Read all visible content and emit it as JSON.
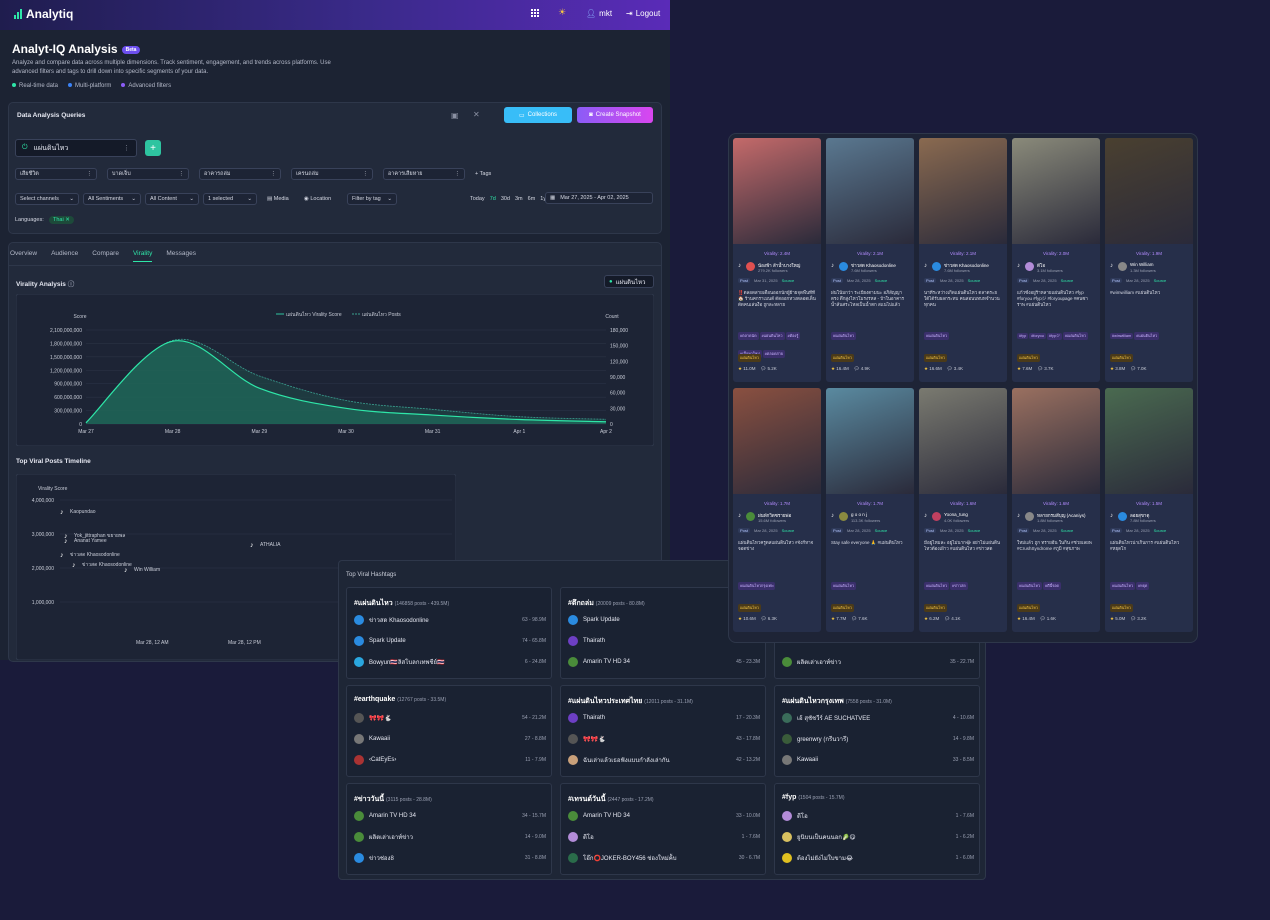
{
  "app": {
    "name": "Analytiq",
    "user": "mkt",
    "logout": "Logout"
  },
  "page": {
    "title": "Analyt-IQ Analysis",
    "badge": "Beta",
    "description": "Analyze and compare data across multiple dimensions. Track sentiment, engagement, and trends across platforms. Use advanced filters and tags to drill down into specific segments of your data.",
    "features": [
      "Real-time data",
      "Multi-platform",
      "Advanced filters"
    ]
  },
  "queries": {
    "title": "Data Analysis Queries",
    "collections": "Collections",
    "snapshot": "Create Snapshot",
    "active_query": "แผ่นดินไหว",
    "tags": [
      "เสียชีวิต",
      "บาดเจ็บ",
      "อาคารถล่ม",
      "เครนถล่ม",
      "อาคารเสียหาย"
    ],
    "tags_label": "Tags",
    "filters": [
      "Select channels",
      "All Sentiments",
      "All Content",
      "1 selected"
    ],
    "media": "Media",
    "location": "Location",
    "filter_by_tag": "Filter by tag",
    "ranges": [
      "Today",
      "7d",
      "30d",
      "3m",
      "6m",
      "1y"
    ],
    "date_range": "Mar 27, 2025 - Apr 02, 2025",
    "languages_label": "Languages:",
    "language": "Thai"
  },
  "tabs": [
    "Overview",
    "Audience",
    "Compare",
    "Virality",
    "Messages"
  ],
  "virality": {
    "title": "Virality Analysis",
    "keyword": "แผ่นดินไหว",
    "legend": [
      "แผ่นดินไหว Virality Score",
      "แผ่นดินไหว Posts"
    ],
    "left_axis": "Score",
    "right_axis": "Count",
    "yticks": [
      "2,100,000,000",
      "1,800,000,000",
      "1,500,000,000",
      "1,200,000,000",
      "900,000,000",
      "600,000,000",
      "300,000,000",
      "0"
    ],
    "y2ticks": [
      "180,000",
      "150,000",
      "120,000",
      "90,000",
      "60,000",
      "30,000",
      "0"
    ],
    "xticks": [
      "Mar 27",
      "Mar 28",
      "Mar 29",
      "Mar 30",
      "Mar 31",
      "Apr 1",
      "Apr 2"
    ]
  },
  "chart_data": {
    "type": "area",
    "x": [
      "Mar 27",
      "Mar 28",
      "Mar 29",
      "Mar 30",
      "Mar 31",
      "Apr 1",
      "Apr 2"
    ],
    "series": [
      {
        "name": "แผ่นดินไหว Virality Score",
        "axis": "left",
        "values": [
          30000000,
          1850000000,
          800000000,
          350000000,
          200000000,
          100000000,
          50000000
        ]
      },
      {
        "name": "แผ่นดินไหว Posts",
        "axis": "right",
        "values": [
          2000,
          160000,
          92000,
          45000,
          28000,
          14000,
          9000
        ]
      }
    ],
    "ylim": [
      0,
      2100000000
    ],
    "y2lim": [
      0,
      180000
    ],
    "ylabel": "Score",
    "y2label": "Count"
  },
  "timeline": {
    "title": "Top Viral Posts Timeline",
    "ylabel": "Virality Score",
    "yticks": [
      "4,000,000",
      "3,000,000",
      "2,000,000",
      "1,000,000"
    ],
    "xticks": [
      "Mar 28, 12 AM",
      "Mar 28, 12 PM"
    ],
    "points": [
      "Kaopundao",
      "Yok_jittraphan ขยายพล",
      "Ananat Yamee",
      "ข่าวสด Khaosodonline",
      "ข่าวสด Khaosodonline",
      "Win William",
      "ATHALIA"
    ]
  },
  "hashtags": {
    "title": "Top Viral Hashtags",
    "cards": [
      {
        "tag": "#แผ่นดินไหว",
        "meta": "(146858 posts - 439.5M)",
        "rows": [
          [
            "ข่าวสด Khaosodonline",
            "63 - 98.9M",
            "#2a8be0"
          ],
          [
            "Spark Update",
            "74 - 65.8M",
            "#2a8be0"
          ],
          [
            "Bowyun🇹🇭ลิสโบลกเทพชีย์🇹🇭",
            "6 - 24.8M",
            "#2aa7e0"
          ]
        ]
      },
      {
        "tag": "#ตึกถล่ม",
        "meta": "(20009 posts - 80.8M)",
        "rows": [
          [
            "Spark Update",
            "",
            "#2a8be0"
          ],
          [
            "Thairath",
            "",
            "#6d3fc4"
          ],
          [
            "Amarin TV HD 34",
            "45 - 23.3M",
            "#4a8c3a"
          ]
        ]
      },
      {
        "tag": "",
        "meta": "",
        "rows": [
          [
            "",
            "",
            "#1a2232"
          ],
          [
            "",
            "",
            "#1a2232"
          ],
          [
            "ผลิตเล่าเอาท์ข่าว",
            "35 - 22.7M",
            "#4a8c3a"
          ]
        ]
      },
      {
        "tag": "#earthquake",
        "meta": "(12767 posts - 33.5M)",
        "rows": [
          [
            "🎀🎀🐇",
            "54 - 21.2M",
            "#555"
          ],
          [
            "Kawaaii",
            "27 - 8.8M",
            "#777"
          ],
          [
            "‹CatEyEs›",
            "11 - 7.9M",
            "#a33"
          ]
        ]
      },
      {
        "tag": "#แผ่นดินไหวประเทศไทย",
        "meta": "(12011 posts - 31.1M)",
        "rows": [
          [
            "Thairath",
            "17 - 20.3M",
            "#6d3fc4"
          ],
          [
            "🎀🎀🐇",
            "43 - 17.8M",
            "#555"
          ],
          [
            "ฉันเล่าแล้วเธอฟังแบบกำลังเล่ากัน",
            "42 - 13.2M",
            "#c9a07a"
          ]
        ]
      },
      {
        "tag": "#แผ่นดินไหวกรุงเทพ",
        "meta": "(7558 posts - 31.0M)",
        "rows": [
          [
            "เอ้ สุชัชวีร์ AE SUCHATVEE",
            "4 - 10.6M",
            "#3a6c5a"
          ],
          [
            "greenwry (กรีนวารี)",
            "14 - 9.8M",
            "#3a5c3a"
          ],
          [
            "Kawaaii",
            "33 - 8.5M",
            "#777"
          ]
        ]
      },
      {
        "tag": "#ข่าววันนี้",
        "meta": "(3115 posts - 28.8M)",
        "rows": [
          [
            "Amarin TV HD 34",
            "34 - 15.7M",
            "#4a8c3a"
          ],
          [
            "ผลิตเล่าเอาท์ข่าว",
            "14 - 9.0M",
            "#4a8c3a"
          ],
          [
            "ข่าวช่อง8",
            "31 - 8.8M",
            "#2a8be0"
          ]
        ]
      },
      {
        "tag": "#เทรนด์วันนี้",
        "meta": "(2447 posts - 17.2M)",
        "rows": [
          [
            "Amarin TV HD 34",
            "33 - 10.0M",
            "#4a8c3a"
          ],
          [
            "ดีโอ",
            "1 - 7.6M",
            "#b38cd8"
          ],
          [
            "โอ๊ก⭕JOKER-BOY456 ช่องใหม่ค้ับ",
            "30 - 6.7M",
            "#2a6c4a"
          ]
        ]
      },
      {
        "tag": "#fyp",
        "meta": "(1504 posts - 15.7M)",
        "rows": [
          [
            "ดีโอ",
            "1 - 7.6M",
            "#b38cd8"
          ],
          [
            "ยูนิบนเป็นคนนอก🥬😋",
            "1 - 6.2M",
            "#d8c060"
          ],
          [
            "ต้องไม่ยังไม่ใบขาม😂",
            "1 - 6.0M",
            "#e0c020"
          ]
        ]
      }
    ]
  },
  "gallery": {
    "cards": [
      {
        "virality": "Virality: 2.4M",
        "name": "น้องฟ้า ส้าน้ำบางใหญ่",
        "followers": "279.2K followers",
        "date": "Mar 31, 2025",
        "text": "‼️ตลอดสายเดือนออกนักผู้ย้ายจุดพื้นที่ที่ 🏠 ร้านคกราเมนต์ ตัดออกหวงตลอดเด็นดัดคนเล่นงือ ถูกละหลาย",
        "tags": [
          "#ตลาดนัด",
          "#แผ่นดินไหว",
          "#ต้องรู้",
          "#เนื้อหาใหม่",
          "#ตลอดสาย"
        ],
        "cat": "แผ่นดินไหว",
        "views": "11.0M",
        "comments": "5.2K",
        "imgc": "#c46a6a",
        "avc": "#e05050"
      },
      {
        "virality": "Virality: 2.1M",
        "name": "ข่าวสด Khaosodonline",
        "followers": "7.6M followers",
        "date": "Mar 28, 2025",
        "text": "ฝนโน้มกว่า ระเบียงตามนะ อภิสัญญาตรง ตึกสูงไหวโมรงรหส - บ้าในอาคาร น้ำล้นสระไหลเป็นน้ำตก สแนไปแล้ว",
        "tags": [
          "#แผ่นดินไหว"
        ],
        "cat": "แผ่นดินไหว",
        "views": "16.4M",
        "comments": "4.9K",
        "imgc": "#5a7890",
        "avc": "#2a8be0"
      },
      {
        "virality": "Virality: 2.1M",
        "name": "ข่าวสด Khaosodonline",
        "followers": "7.6M followers",
        "date": "Mar 28, 2025",
        "text": "นาทีระหว่างเกิดแผ่นดินไหว ตลาดระยใต้ได้รับผลกระทบ คนสอนบทบทจำนวนทุกคน",
        "tags": [
          "#แผ่นดินไหว"
        ],
        "cat": "แผ่นดินไหว",
        "views": "16.6M",
        "comments": "3.4K",
        "imgc": "#8a6a50",
        "avc": "#2a8be0"
      },
      {
        "virality": "Virality: 2.0M",
        "name": "ดีโอ",
        "followers": "3.1M followers",
        "date": "Mar 28, 2025",
        "text": "แก้วซั้งอยู่ร้าหลายแผ่นดินไหว #fyp #foryou #fypジ #foryoupage #คนซาราพ #แผ่นดินไหว",
        "tags": [
          "#fyp",
          "#foryou",
          "#fypジ",
          "#แผ่นดินไหว"
        ],
        "cat": "แผ่นดินไหว",
        "views": "7.6M",
        "comments": "3.7K",
        "imgc": "#8a8a7a",
        "avc": "#b38cd8"
      },
      {
        "virality": "Virality: 1.9M",
        "name": "Win William",
        "followers": "1.3M followers",
        "date": "Mar 28, 2025",
        "text": "#wimwilliam #แผ่นดินไหว",
        "tags": [
          "#winwilliam",
          "#แผ่นดินไหว"
        ],
        "cat": "แผ่นดินไหว",
        "views": "3.8M",
        "comments": "7.0K",
        "imgc": "#4a4030",
        "avc": "#888"
      },
      {
        "virality": "Virality: 1.7M",
        "name": "ฝนพักวิตซรายพ่อ",
        "followers": "15.6M followers",
        "date": "Mar 28, 2025",
        "text": "แผ่นดินไหวครูดสแผ่นดินไหว #จังกีหาจจอดข่าง",
        "tags": [
          "#แผ่นดินไหวกรุงเทพ"
        ],
        "cat": "แผ่นดินไหว",
        "views": "10.6M",
        "comments": "6.3K",
        "imgc": "#8a5040",
        "avc": "#4a8c3a"
      },
      {
        "virality": "Virality: 1.7M",
        "name": "g o o n j",
        "followers": "113.3K followers",
        "date": "Mar 28, 2025",
        "text": "Stay safe everyone 🙏 #แผ่นดินไหว",
        "tags": [
          "#แผ่นดินไหว"
        ],
        "cat": "แผ่นดินไหว",
        "views": "7.7M",
        "comments": "7.6K",
        "imgc": "#5a8aa0",
        "avc": "#8a8a40"
      },
      {
        "virality": "Virality: 1.6M",
        "name": "Yoona_tung",
        "followers": "4.0K followers",
        "date": "Mar 28, 2025",
        "text": "มีอยู่ไหมละ อยู่ไม่นาก😂 อย่าไม่แผ่นดินไหวต้องเฝ้าว #แผ่นดินไหว #ข่าวสด",
        "tags": [
          "#แผ่นดินไหว",
          "#ข่าวสด"
        ],
        "cat": "แผ่นดินไหว",
        "views": "6.2M",
        "comments": "4.1K",
        "imgc": "#7a7a70",
        "avc": "#c04060"
      },
      {
        "virality": "Virality: 1.6M",
        "name": "หลายกรมสีบุญ (Acaniys)",
        "followers": "1.8M followers",
        "date": "Mar 28, 2025",
        "text": "ใหม่แล้ว ถูก ทรายอีน ในกิน #ช่วยเลยพ #CrushSyndrome #ภูมิ #สุขภาพ",
        "tags": [
          "#แผ่นดินไหว",
          "#ตีนี้รอด"
        ],
        "cat": "แผ่นดินไหว",
        "views": "16.4M",
        "comments": "1.6K",
        "imgc": "#9a7060",
        "avc": "#888"
      },
      {
        "virality": "Virality: 1.5M",
        "name": "ลอยสุขาดุ",
        "followers": "7.8M followers",
        "date": "Mar 28, 2025",
        "text": "แผ่นดินไหวน่าเกินการ #แผ่นดินไหว #หยุดโก",
        "tags": [
          "#แผ่นดินไหว",
          "#หยุด"
        ],
        "cat": "แผ่นดินไหว",
        "views": "5.0M",
        "comments": "3.2K",
        "imgc": "#4a6a50",
        "avc": "#2a8be0"
      }
    ],
    "post_label": "Post",
    "source_label": "Source"
  }
}
